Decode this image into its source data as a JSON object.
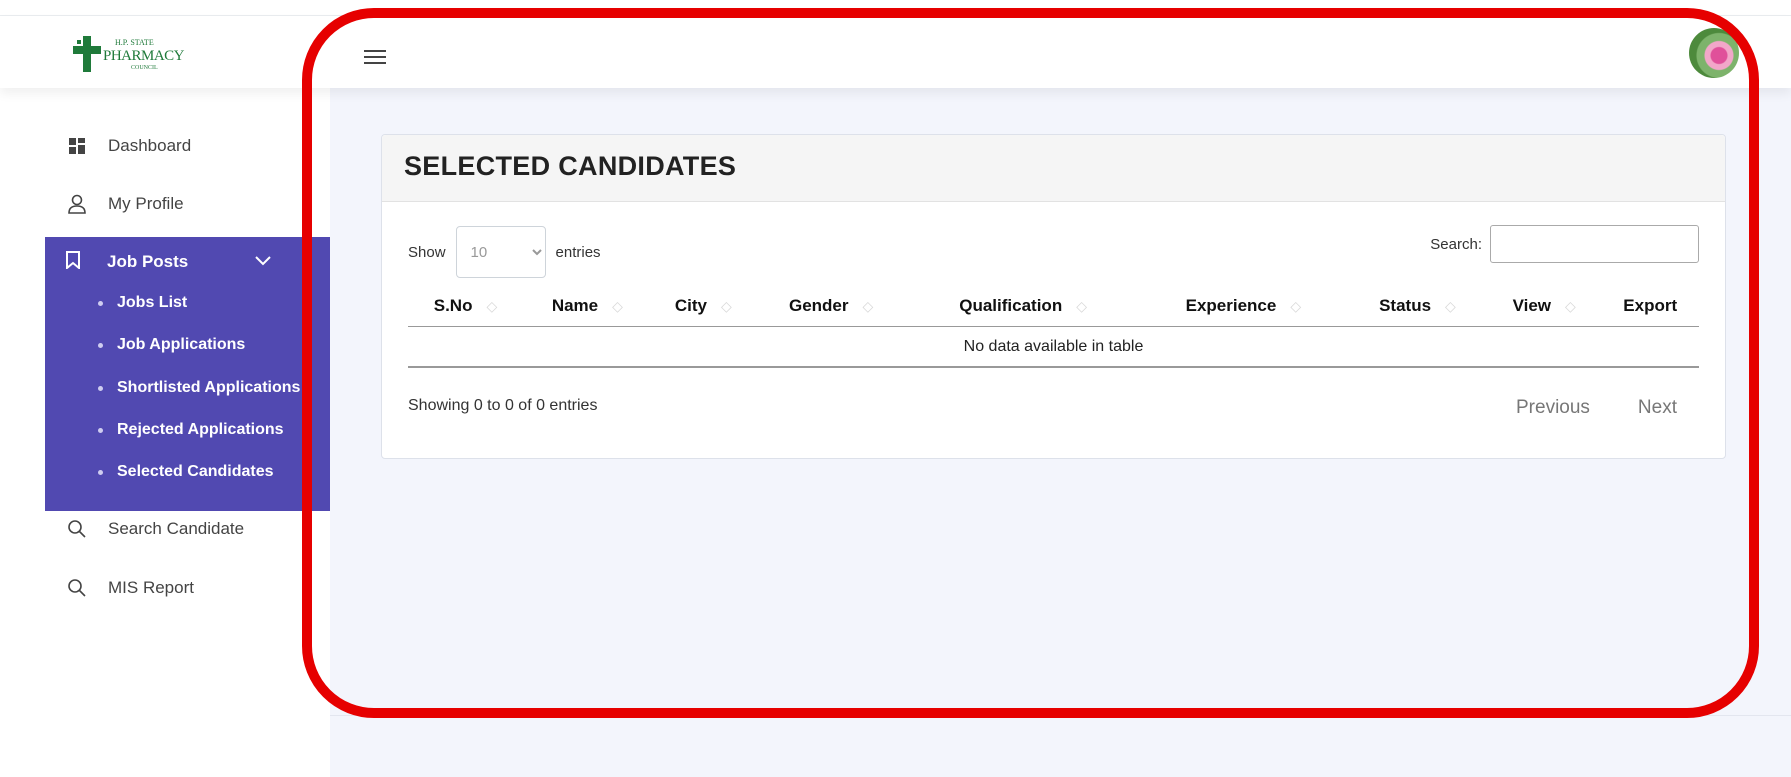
{
  "header": {
    "logo_small": "H.P. STATE",
    "logo_main": "PHARMACY",
    "logo_council": "COUNCIL"
  },
  "sidebar": {
    "items": [
      {
        "label": "Dashboard",
        "icon": "dashboard-icon"
      },
      {
        "label": "My Profile",
        "icon": "user-icon"
      }
    ],
    "group": {
      "label": "Job Posts",
      "icon": "bookmark-icon",
      "subitems": [
        "Jobs List",
        "Job Applications",
        "Shortlisted Applications",
        "Rejected Applications",
        "Selected Candidates"
      ]
    },
    "bottom_items": [
      {
        "label": "Search Candidate",
        "icon": "search-icon"
      },
      {
        "label": "MIS Report",
        "icon": "search-icon"
      }
    ]
  },
  "main": {
    "title": "SELECTED CANDIDATES",
    "length_prefix": "Show",
    "length_value": "10",
    "length_suffix": "entries",
    "search_label": "Search:",
    "columns": [
      "S.No",
      "Name",
      "City",
      "Gender",
      "Qualification",
      "Experience",
      "Status",
      "View",
      "Export"
    ],
    "empty_text": "No data available in table",
    "info": "Showing 0 to 0 of 0 entries",
    "prev": "Previous",
    "next": "Next"
  },
  "colors": {
    "sidebar_active": "#5149b1",
    "content_bg": "#f3f5fc",
    "highlight": "#e60000"
  }
}
